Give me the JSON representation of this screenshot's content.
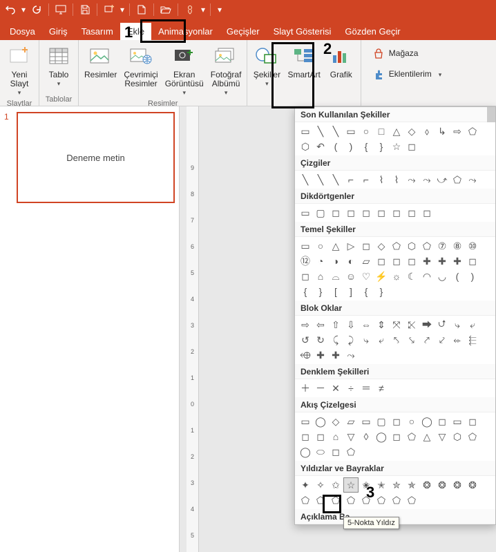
{
  "qat": {
    "items": [
      "undo",
      "redo",
      "present",
      "save",
      "new-slide",
      "new-file",
      "open",
      "touch-mode"
    ]
  },
  "tabs": {
    "items": [
      {
        "id": "dosya",
        "label": "Dosya"
      },
      {
        "id": "giris",
        "label": "Giriş"
      },
      {
        "id": "tasarim",
        "label": "Tasarım"
      },
      {
        "id": "ekle",
        "label": "Ekle"
      },
      {
        "id": "animasyonlar",
        "label": "Animasyonlar"
      },
      {
        "id": "gecisler",
        "label": "Geçişler"
      },
      {
        "id": "slayt",
        "label": "Slayt Gösterisi"
      },
      {
        "id": "gozden",
        "label": "Gözden Geçir"
      }
    ],
    "active": "ekle"
  },
  "ribbon": {
    "groups": {
      "slaytlar": {
        "label": "Slaytlar",
        "new_slide": "Yeni\nSlayt"
      },
      "tablolar": {
        "label": "Tablolar",
        "tablo": "Tablo"
      },
      "resimler": {
        "label": "Resimler",
        "resimler": "Resimler",
        "online": "Çevrimiçi\nResimler",
        "screenshot": "Ekran\nGörüntüsü",
        "album": "Fotoğraf\nAlbümü"
      },
      "cizimler": {
        "sekiller": "Şekiller",
        "smartart": "SmartArt",
        "grafik": "Grafik"
      },
      "store": {
        "magaza": "Mağaza",
        "eklentiler": "Eklentilerim"
      }
    }
  },
  "thumbnail": {
    "index": "1",
    "text": "Deneme metin"
  },
  "ruler_marks": [
    "9",
    "8",
    "7",
    "6",
    "5",
    "4",
    "3",
    "2",
    "1",
    "0",
    "1",
    "2",
    "3",
    "4",
    "5"
  ],
  "annotations": {
    "step1": "1",
    "step2": "2",
    "step3": "3"
  },
  "shapes_dd": {
    "cats": [
      {
        "id": "recent",
        "label": "Son Kullanılan Şekiller",
        "count": 20
      },
      {
        "id": "lines",
        "label": "Çizgiler",
        "count": 12
      },
      {
        "id": "rects",
        "label": "Dikdörtgenler",
        "count": 9
      },
      {
        "id": "basic",
        "label": "Temel Şekiller",
        "count": 42
      },
      {
        "id": "arrows",
        "label": "Blok Oklar",
        "count": 28
      },
      {
        "id": "eqn",
        "label": "Denklem Şekilleri",
        "count": 6
      },
      {
        "id": "flow",
        "label": "Akış Çizelgesi",
        "count": 28
      },
      {
        "id": "stars",
        "label": "Yıldızlar ve Bayraklar",
        "count": 20
      },
      {
        "id": "callout",
        "label": "Açıklama Ba",
        "count": 0
      }
    ],
    "tooltip": "5-Nokta Yıldız"
  }
}
